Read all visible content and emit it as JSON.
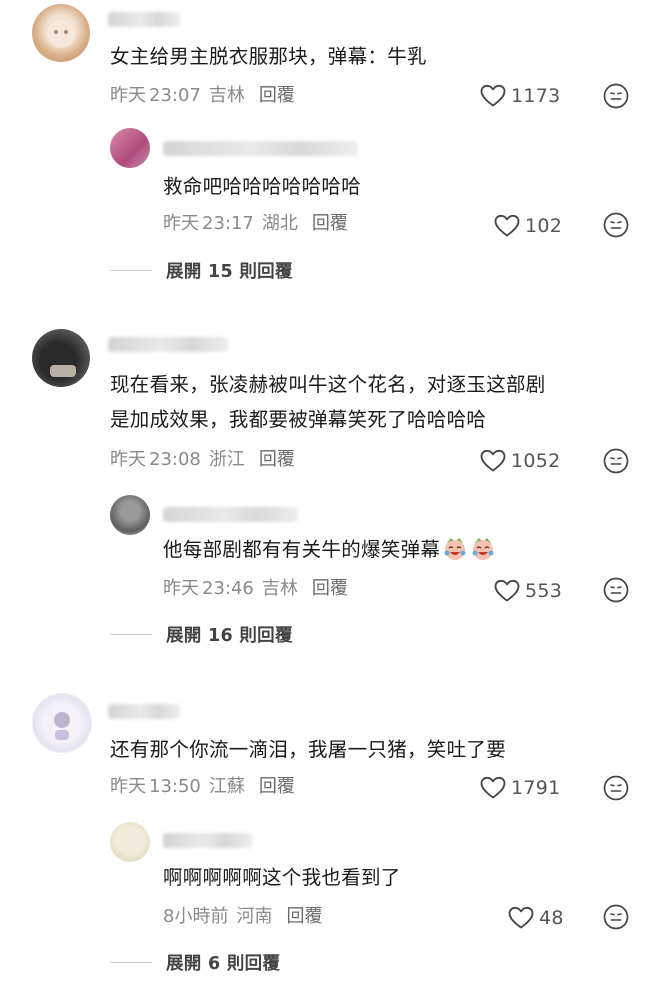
{
  "threads": [
    {
      "comment": {
        "text_lines": [
          "女主给男主脱衣服那块，弹幕：牛乳"
        ],
        "date": "昨天",
        "time": "23:07",
        "location": "吉林",
        "reply_label": "回覆",
        "likes": "1173"
      },
      "reply": {
        "text": "救命吧哈哈哈哈哈哈哈",
        "date": "昨天",
        "time": "23:17",
        "location": "湖北",
        "reply_label": "回覆",
        "likes": "102"
      },
      "expand_label": "展開 15 則回覆"
    },
    {
      "comment": {
        "text_lines": [
          "现在看来，张凌赫被叫牛这个花名，对逐玉这部剧",
          "是加成效果，我都要被弹幕笑死了哈哈哈哈"
        ],
        "date": "昨天",
        "time": "23:08",
        "location": "浙江",
        "reply_label": "回覆",
        "likes": "1052"
      },
      "reply": {
        "text": "他每部剧都有有关牛的爆笑弹幕",
        "date": "昨天",
        "time": "23:46",
        "location": "吉林",
        "reply_label": "回覆",
        "likes": "553"
      },
      "expand_label": "展開 16 則回覆"
    },
    {
      "comment": {
        "text_lines": [
          "还有那个你流一滴泪，我屠一只猪，笑吐了要"
        ],
        "date": "昨天",
        "time": "13:50",
        "location": "江蘇",
        "reply_label": "回覆",
        "likes": "1791"
      },
      "reply": {
        "text": "啊啊啊啊啊这个我也看到了",
        "date": "8小時前",
        "time": "",
        "location": "河南",
        "reply_label": "回覆",
        "likes": "48"
      },
      "expand_label": "展開 6 則回覆"
    }
  ],
  "icons": {
    "like": "heart-outline-icon",
    "reaction": "smile-face-icon",
    "inline_emoji": "laugh-cry-face-icon"
  },
  "colors": {
    "text": "#1b1b1b",
    "meta": "#8a8a8a",
    "reply": "#6b6b6b",
    "divider": "#cfcfcf"
  }
}
